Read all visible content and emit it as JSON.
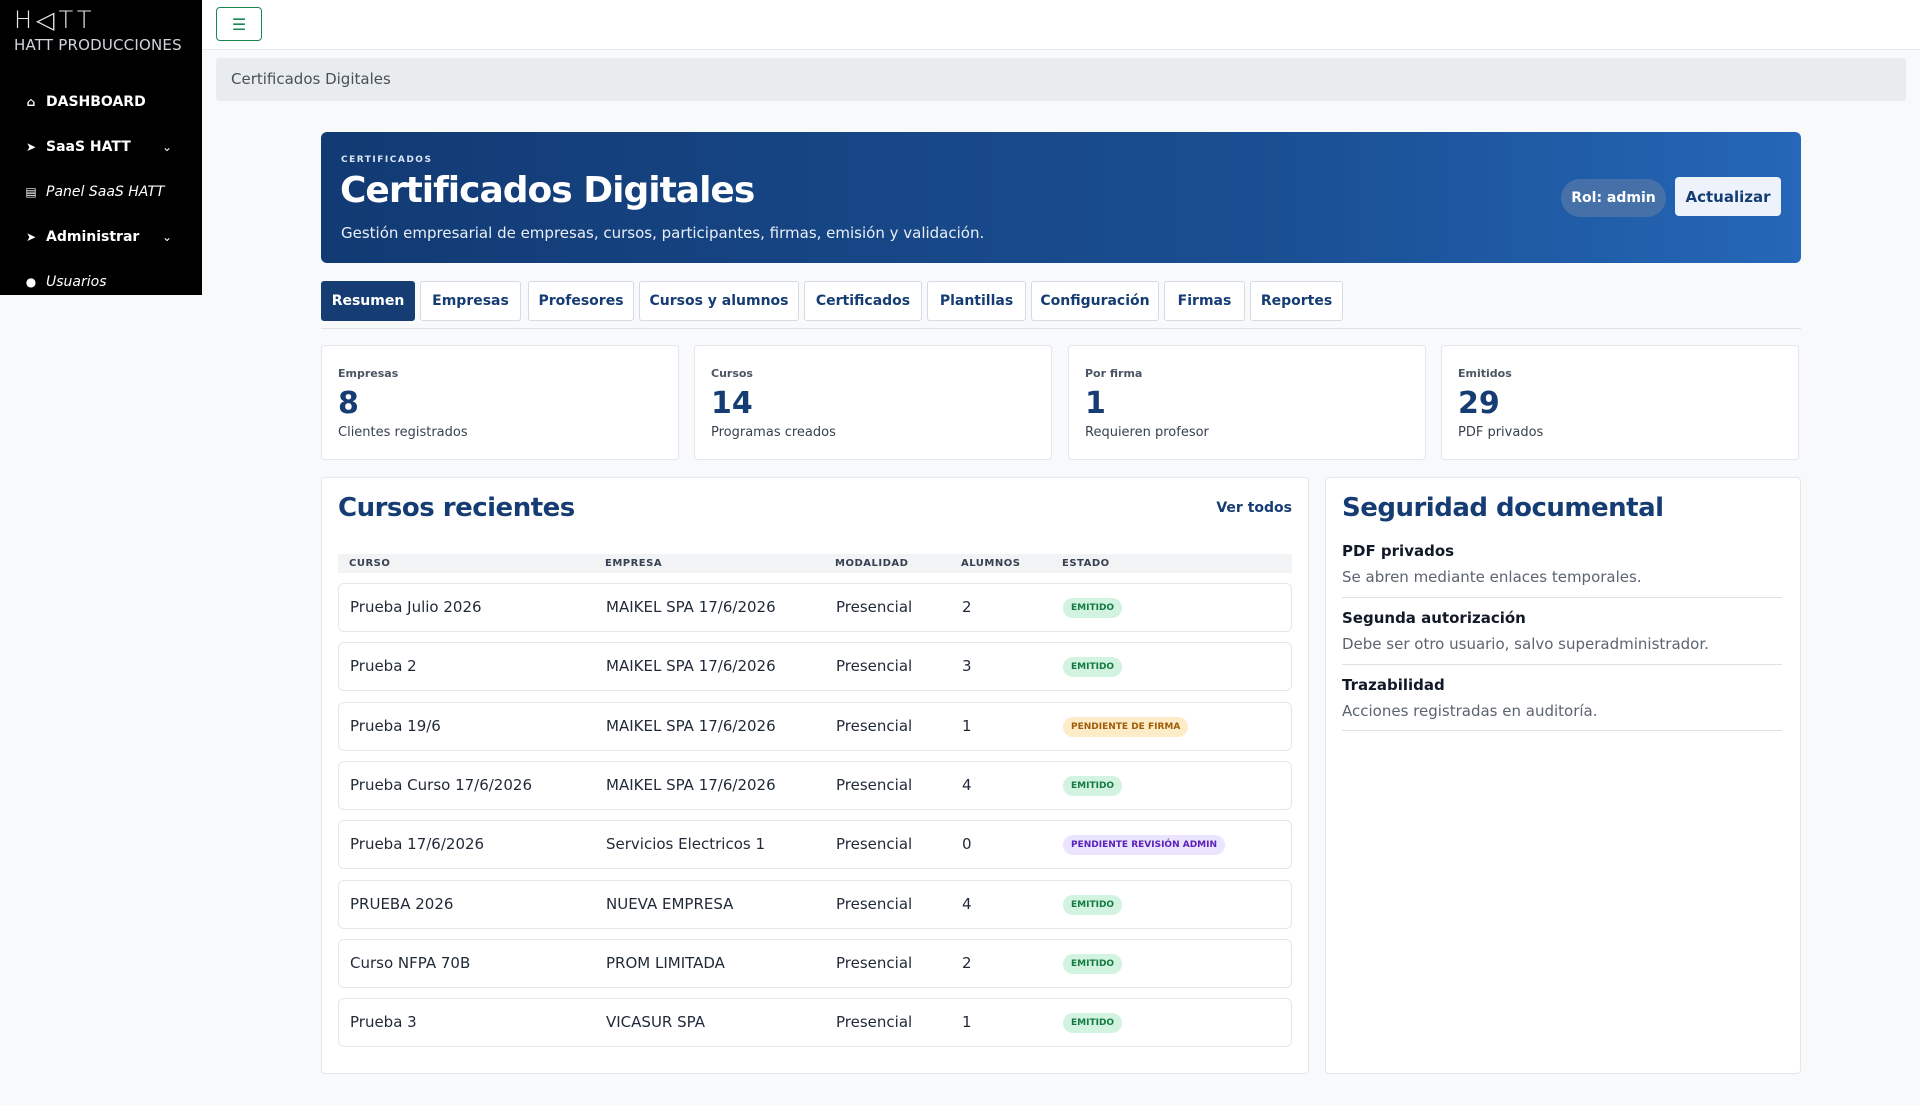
{
  "sidebar": {
    "logo": "H◁TT",
    "brand": "HATT PRODUCCIONES",
    "items": [
      {
        "label": "DASHBOARD",
        "icon": "home-icon"
      },
      {
        "label": "SaaS HATT",
        "icon": "chevron-right-icon"
      },
      {
        "label": "Panel SaaS HATT",
        "icon": "building-icon"
      },
      {
        "label": "Administrar",
        "icon": "chevron-right-icon"
      },
      {
        "label": "Usuarios",
        "icon": "user-circle-icon"
      }
    ]
  },
  "breadcrumb": "Certificados Digitales",
  "hero": {
    "eyebrow": "CERTIFICADOS",
    "title": "Certificados Digitales",
    "subtitle": "Gestión empresarial de empresas, cursos, participantes, firmas, emisión y validación.",
    "role": "Rol: admin",
    "update": "Actualizar"
  },
  "tabs": [
    "Resumen",
    "Empresas",
    "Profesores",
    "Cursos y alumnos",
    "Certificados",
    "Plantillas",
    "Configuración",
    "Firmas",
    "Reportes"
  ],
  "stats": [
    {
      "label": "Empresas",
      "value": "8",
      "desc": "Clientes registrados"
    },
    {
      "label": "Cursos",
      "value": "14",
      "desc": "Programas creados"
    },
    {
      "label": "Por firma",
      "value": "1",
      "desc": "Requieren profesor"
    },
    {
      "label": "Emitidos",
      "value": "29",
      "desc": "PDF privados"
    }
  ],
  "courses": {
    "title": "Cursos recientes",
    "see_all": "Ver todos",
    "headers": [
      "CURSO",
      "EMPRESA",
      "MODALIDAD",
      "ALUMNOS",
      "ESTADO"
    ],
    "rows": [
      {
        "curso": "Prueba Julio 2026",
        "empresa": "MAIKEL SPA 17/6/2026",
        "modalidad": "Presencial",
        "alumnos": "2",
        "estado": "EMITIDO",
        "tone": "green"
      },
      {
        "curso": "Prueba 2",
        "empresa": "MAIKEL SPA 17/6/2026",
        "modalidad": "Presencial",
        "alumnos": "3",
        "estado": "EMITIDO",
        "tone": "green"
      },
      {
        "curso": "Prueba 19/6",
        "empresa": "MAIKEL SPA 17/6/2026",
        "modalidad": "Presencial",
        "alumnos": "1",
        "estado": "PENDIENTE DE FIRMA",
        "tone": "amber"
      },
      {
        "curso": "Prueba Curso 17/6/2026",
        "empresa": "MAIKEL SPA 17/6/2026",
        "modalidad": "Presencial",
        "alumnos": "4",
        "estado": "EMITIDO",
        "tone": "green"
      },
      {
        "curso": "Prueba 17/6/2026",
        "empresa": "Servicios Electricos 1",
        "modalidad": "Presencial",
        "alumnos": "0",
        "estado": "PENDIENTE REVISIÓN ADMIN",
        "tone": "purple"
      },
      {
        "curso": "PRUEBA 2026",
        "empresa": "NUEVA EMPRESA",
        "modalidad": "Presencial",
        "alumnos": "4",
        "estado": "EMITIDO",
        "tone": "green"
      },
      {
        "curso": "Curso NFPA 70B",
        "empresa": "PROM LIMITADA",
        "modalidad": "Presencial",
        "alumnos": "2",
        "estado": "EMITIDO",
        "tone": "green"
      },
      {
        "curso": "Prueba 3",
        "empresa": "VICASUR SPA",
        "modalidad": "Presencial",
        "alumnos": "1",
        "estado": "EMITIDO",
        "tone": "green"
      }
    ]
  },
  "security": {
    "title": "Seguridad documental",
    "items": [
      {
        "title": "PDF privados",
        "desc": "Se abren mediante enlaces temporales."
      },
      {
        "title": "Segunda autorización",
        "desc": "Debe ser otro usuario, salvo superadministrador."
      },
      {
        "title": "Trazabilidad",
        "desc": "Acciones registradas en auditoría."
      }
    ]
  },
  "colors": {
    "primary": "#163d73",
    "accent_green": "#198754"
  }
}
